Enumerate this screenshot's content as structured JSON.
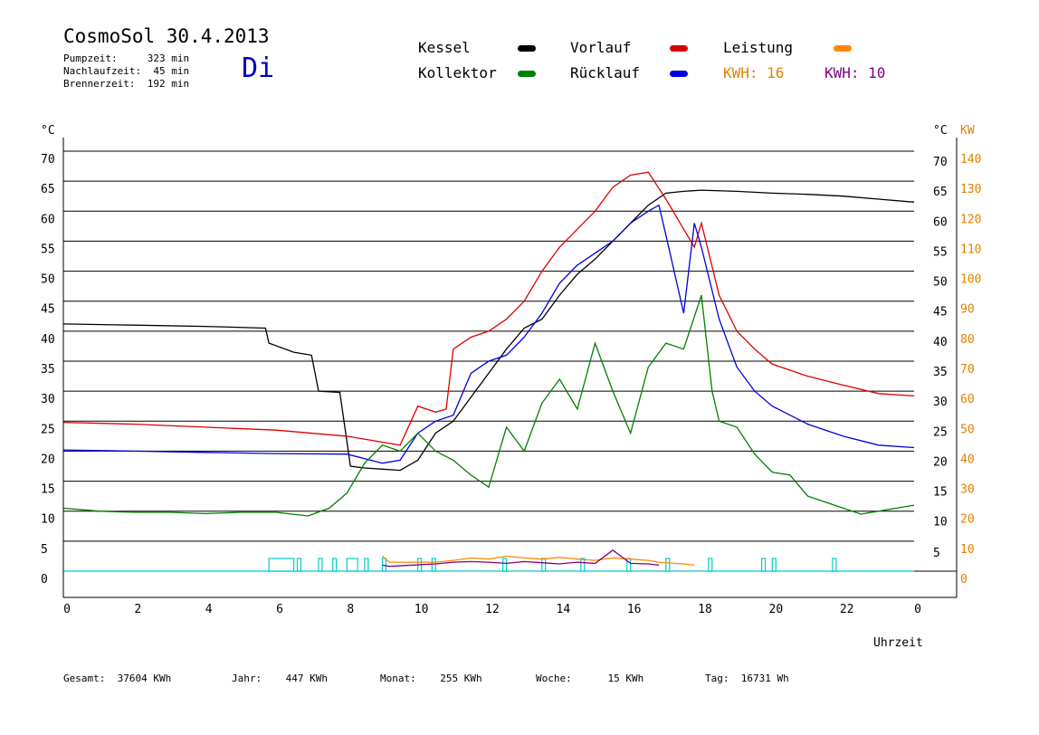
{
  "header": {
    "title": "CosmoSol 30.4.2013",
    "day": "Di",
    "pumpzeit": "Pumpzeit:     323 min",
    "nachlaufzeit": "Nachlaufzeit:  45 min",
    "brennerzeit": "Brennerzeit:  192 min"
  },
  "legend": {
    "kessel": {
      "label": "Kessel",
      "color": "#000000"
    },
    "vorlauf": {
      "label": "Vorlauf",
      "color": "#dd0000"
    },
    "leistung": {
      "label": "Leistung",
      "color": "#ff8800"
    },
    "kollektor": {
      "label": "Kollektor",
      "color": "#008000"
    },
    "ruecklauf": {
      "label": "Rücklauf",
      "color": "#0000dd"
    },
    "kwh_a": {
      "label": "KWH: 16",
      "color": "#e08000"
    },
    "kwh_b": {
      "label": "KWH: 10",
      "color": "#800080"
    }
  },
  "footer": {
    "gesamt": "Gesamt:  37604 KWh",
    "jahr": "Jahr:    447 KWh",
    "monat": "Monat:    255 KWh",
    "woche": "Woche:      15 KWh",
    "tag": "Tag:  16731 Wh"
  },
  "chart_data": {
    "type": "line",
    "xlabel": "Uhrzeit",
    "ylabel_left": "°C",
    "ylabel_right_temp": "°C",
    "ylabel_right_power": "KW",
    "xlim": [
      0,
      24
    ],
    "ylim": [
      0,
      70
    ],
    "x_ticks": [
      "0",
      "2",
      "4",
      "6",
      "8",
      "10",
      "12",
      "14",
      "16",
      "18",
      "20",
      "22",
      "0"
    ],
    "y_ticks_left": [
      "0",
      "5",
      "10",
      "15",
      "20",
      "25",
      "30",
      "35",
      "40",
      "45",
      "50",
      "55",
      "60",
      "65",
      "70"
    ],
    "y_ticks_right_temp": [
      "10",
      "15",
      "20",
      "25",
      "30",
      "35",
      "40",
      "45",
      "50",
      "55",
      "60",
      "65",
      "70"
    ],
    "y_ticks_right_power": [
      "0",
      "10",
      "20",
      "30",
      "40",
      "50",
      "60",
      "70",
      "80",
      "90",
      "100",
      "110",
      "120",
      "130",
      "140"
    ],
    "y_ticks_right_low": [
      "5"
    ],
    "grid": "horizontal",
    "series": [
      {
        "name": "Kessel",
        "color": "#000000",
        "x": [
          0,
          2,
          4,
          5.7,
          5.8,
          6.5,
          7.0,
          7.2,
          7.8,
          8.1,
          8.5,
          9.0,
          9.5,
          10.0,
          10.5,
          11.0,
          11.5,
          12.0,
          12.5,
          13.0,
          13.5,
          14.0,
          14.5,
          15.0,
          15.5,
          16.0,
          16.5,
          17.0,
          17.5,
          18.0,
          19.0,
          20.0,
          21.0,
          22.0,
          23.0,
          24.0
        ],
        "y": [
          41.2,
          41.0,
          40.8,
          40.5,
          38.0,
          36.5,
          36.0,
          30.0,
          29.8,
          17.5,
          17.2,
          17.0,
          16.8,
          18.5,
          23.0,
          25.0,
          29.0,
          33.0,
          37.0,
          40.5,
          42.0,
          46.0,
          49.5,
          52.0,
          55.0,
          58.0,
          61.0,
          63.0,
          63.3,
          63.5,
          63.3,
          63.0,
          62.8,
          62.5,
          62.0,
          61.5
        ]
      },
      {
        "name": "Vorlauf",
        "color": "#dd0000",
        "x": [
          0,
          2,
          4,
          6,
          8,
          9.0,
          9.5,
          10.0,
          10.5,
          10.8,
          11.0,
          11.5,
          12.0,
          12.5,
          13.0,
          13.5,
          14.0,
          14.5,
          15.0,
          15.5,
          16.0,
          16.5,
          17.0,
          17.5,
          17.8,
          18.0,
          18.5,
          19.0,
          19.5,
          20.0,
          21.0,
          22.0,
          23.0,
          24.0
        ],
        "y": [
          24.8,
          24.5,
          24.0,
          23.5,
          22.5,
          21.5,
          21.0,
          27.5,
          26.5,
          27.0,
          37.0,
          39.0,
          40.0,
          42.0,
          45.0,
          50.0,
          54.0,
          57.0,
          60.0,
          64.0,
          66.0,
          66.5,
          62.0,
          57.0,
          54.0,
          58.0,
          46.0,
          40.0,
          37.0,
          34.5,
          32.5,
          31.0,
          29.6,
          29.2
        ]
      },
      {
        "name": "Rücklauf",
        "color": "#0000dd",
        "x": [
          0,
          2,
          4,
          6,
          8,
          9.0,
          9.5,
          10.0,
          10.5,
          11.0,
          11.5,
          12.0,
          12.5,
          13.0,
          13.5,
          14.0,
          14.5,
          15.0,
          15.5,
          16.0,
          16.5,
          16.8,
          17.0,
          17.5,
          17.8,
          18.0,
          18.5,
          19.0,
          19.5,
          20.0,
          21.0,
          22.0,
          23.0,
          24.0
        ],
        "y": [
          20.2,
          20.0,
          19.8,
          19.6,
          19.5,
          18.0,
          18.5,
          23.0,
          25.0,
          26.0,
          33.0,
          35.0,
          36.0,
          39.0,
          43.0,
          48.0,
          51.0,
          53.0,
          55.0,
          58.0,
          60.0,
          61.0,
          56.0,
          43.0,
          58.0,
          54.0,
          42.0,
          34.0,
          30.0,
          27.5,
          24.5,
          22.5,
          21.0,
          20.6
        ]
      },
      {
        "name": "Kollektor",
        "color": "#008000",
        "x": [
          0,
          1,
          2,
          3,
          4,
          5,
          6,
          6.9,
          7.5,
          8.0,
          8.5,
          9.0,
          9.5,
          10.0,
          10.5,
          11.0,
          11.5,
          12.0,
          12.5,
          13.0,
          13.5,
          14.0,
          14.5,
          15.0,
          15.5,
          16.0,
          16.5,
          17.0,
          17.5,
          18.0,
          18.3,
          18.5,
          19.0,
          19.5,
          20.0,
          20.5,
          21.0,
          21.5,
          22.0,
          22.5,
          23.0,
          23.5,
          24.0
        ],
        "y": [
          10.5,
          10.0,
          9.8,
          9.8,
          9.6,
          9.8,
          9.8,
          9.2,
          10.5,
          13.0,
          18.0,
          21.0,
          20.0,
          23.0,
          20.0,
          18.5,
          16.0,
          14.0,
          24.0,
          20.0,
          28.0,
          32.0,
          27.0,
          38.0,
          30.0,
          23.0,
          34.0,
          38.0,
          37.0,
          46.0,
          30.0,
          25.0,
          24.0,
          19.5,
          16.5,
          16.0,
          12.5,
          11.5,
          10.5,
          9.5,
          10.0,
          10.5,
          11.0
        ]
      },
      {
        "name": "Leistung",
        "color": "#ff8800",
        "x": [
          9.0,
          9.2,
          10.5,
          11.0,
          11.5,
          12.0,
          12.5,
          13.0,
          13.5,
          14.0,
          14.5,
          15.0,
          15.5,
          16.0,
          16.5,
          16.8,
          17.5,
          17.8
        ],
        "y": [
          2.5,
          1.5,
          1.5,
          1.8,
          2.2,
          2.0,
          2.5,
          2.2,
          2.0,
          2.3,
          2.0,
          1.8,
          2.2,
          2.0,
          1.8,
          1.5,
          1.2,
          1.0
        ]
      },
      {
        "name": "KWH: 10",
        "color": "#800080",
        "x": [
          9.0,
          9.2,
          10.5,
          11.0,
          11.5,
          12.0,
          12.5,
          13.0,
          13.5,
          14.0,
          14.5,
          15.0,
          15.5,
          16.0,
          16.5,
          16.8
        ],
        "y": [
          1.0,
          0.8,
          1.2,
          1.5,
          1.6,
          1.5,
          1.3,
          1.6,
          1.4,
          1.2,
          1.5,
          1.3,
          3.5,
          1.3,
          1.2,
          1.0
        ]
      }
    ],
    "pump_on_intervals": [
      [
        5.8,
        6.5
      ],
      [
        6.6,
        6.7
      ],
      [
        7.2,
        7.3
      ],
      [
        7.6,
        7.7
      ],
      [
        8.0,
        8.3
      ],
      [
        8.5,
        8.6
      ],
      [
        9.0,
        9.1
      ],
      [
        10.0,
        10.1
      ],
      [
        10.4,
        10.5
      ],
      [
        12.4,
        12.5
      ],
      [
        13.5,
        13.6
      ],
      [
        14.6,
        14.7
      ],
      [
        15.9,
        16.0
      ],
      [
        17.0,
        17.1
      ],
      [
        18.2,
        18.3
      ],
      [
        19.7,
        19.8
      ],
      [
        20.0,
        20.1
      ],
      [
        21.7,
        21.8
      ]
    ]
  }
}
